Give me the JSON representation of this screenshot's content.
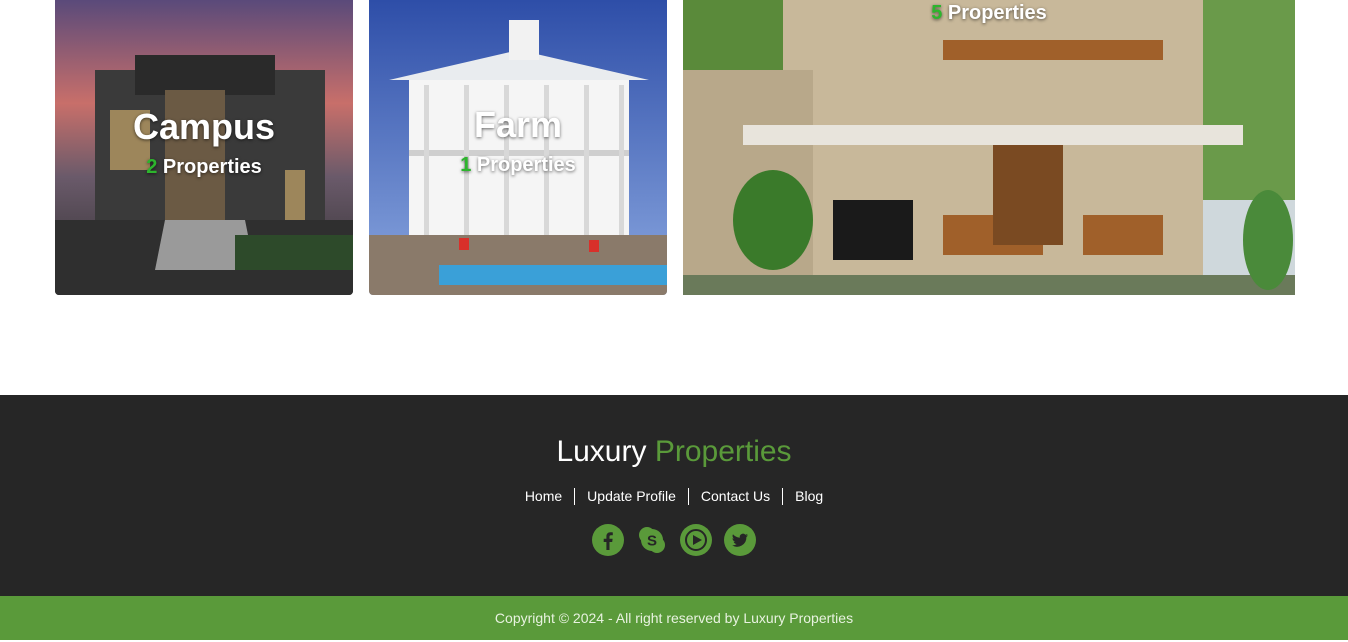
{
  "cards": [
    {
      "title": "Campus",
      "count": "2",
      "suffix": "Properties"
    },
    {
      "title": "Farm",
      "count": "1",
      "suffix": "Properties"
    },
    {
      "title": "",
      "count": "5",
      "suffix": "Properties"
    }
  ],
  "footer": {
    "brand_main": "Luxury",
    "brand_accent": "Properties",
    "nav": [
      "Home",
      "Update Profile",
      "Contact Us",
      "Blog"
    ],
    "social_icons": [
      "facebook-icon",
      "skype-icon",
      "youtube-icon",
      "twitter-icon"
    ],
    "copyright": "Copyright © 2024 - All right reserved by Luxury Properties"
  },
  "colors": {
    "accent": "#5a9a3a",
    "count_green": "#2db52d",
    "footer_bg": "#262626"
  }
}
